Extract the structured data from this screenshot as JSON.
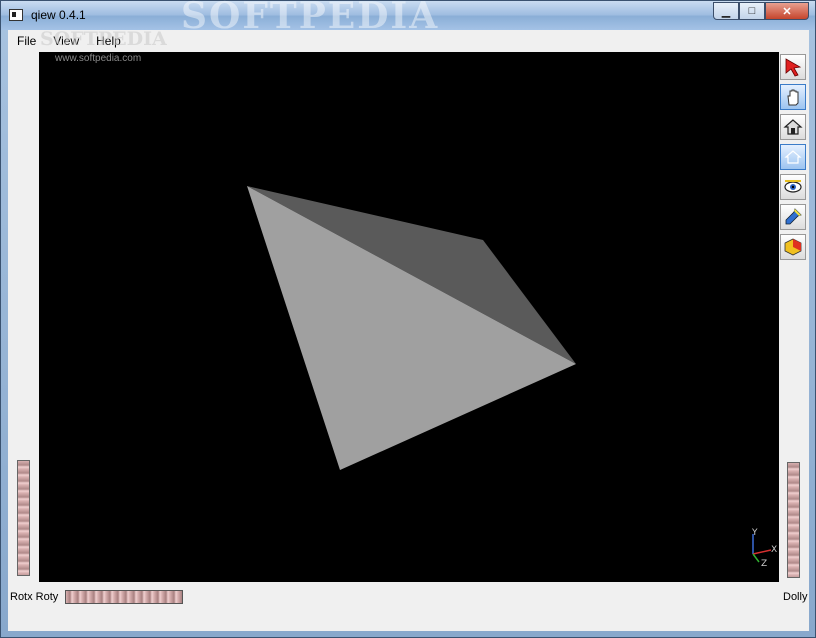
{
  "window": {
    "title": "qiew 0.4.1",
    "watermark": "SOFTPEDIA",
    "controls": {
      "minimize": "▁",
      "maximize": "□",
      "close": "✕"
    }
  },
  "menubar": {
    "items": [
      {
        "label": "File"
      },
      {
        "label": "View"
      },
      {
        "label": "Help"
      }
    ],
    "watermark": "SOFTPEDIA"
  },
  "viewport": {
    "site_watermark": "www.softpedia.com",
    "background": "#000000",
    "axes": {
      "x": "X",
      "y": "Y",
      "z": "Z"
    }
  },
  "toolbar": {
    "tools": [
      {
        "icon": "arrow-pointer-icon",
        "active": false
      },
      {
        "icon": "hand-icon",
        "active": true
      },
      {
        "icon": "home-icon",
        "active": false
      },
      {
        "icon": "set-home-icon",
        "active": true
      },
      {
        "icon": "eye-icon",
        "active": false
      },
      {
        "icon": "flashlight-icon",
        "active": false
      },
      {
        "icon": "perspective-cube-icon",
        "active": false
      }
    ]
  },
  "bottom": {
    "rot_label": "Rotx Roty",
    "dolly_label": "Dolly"
  }
}
